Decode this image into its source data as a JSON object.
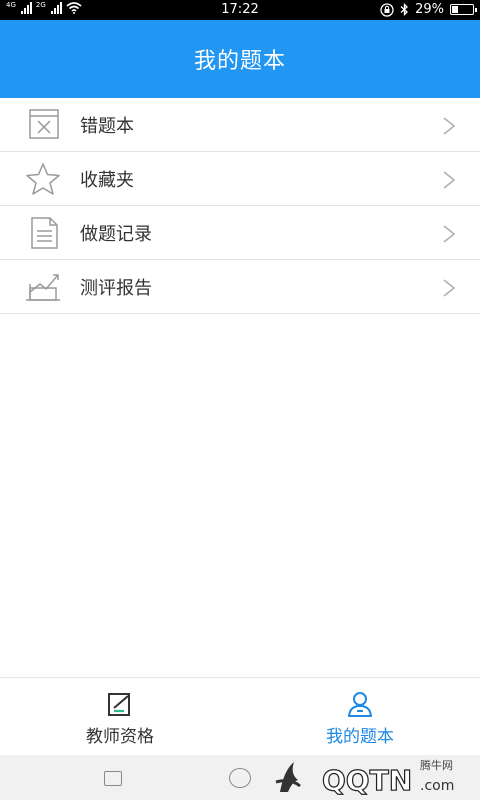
{
  "status_bar": {
    "time": "17:22",
    "battery": "29%",
    "battery_level": 0.29,
    "signal_label": "4G",
    "signal_label_2": "2G"
  },
  "header": {
    "title": "我的题本"
  },
  "menu": {
    "items": [
      {
        "label": "错题本",
        "icon": "wrong-questions-icon"
      },
      {
        "label": "收藏夹",
        "icon": "star-icon"
      },
      {
        "label": "做题记录",
        "icon": "document-icon"
      },
      {
        "label": "测评报告",
        "icon": "chart-icon"
      }
    ]
  },
  "tabs": [
    {
      "label": "教师资格",
      "icon": "edit-icon",
      "active": false
    },
    {
      "label": "我的题本",
      "icon": "user-icon",
      "active": true
    }
  ],
  "colors": {
    "header": "#2196f3",
    "active_tab": "#1e88e5",
    "inactive_tab": "#333333",
    "icon_gray": "#9a9a9a"
  },
  "watermark": {
    "text": "QQTN",
    "suffix": ".com",
    "small_text": "腾牛网"
  }
}
